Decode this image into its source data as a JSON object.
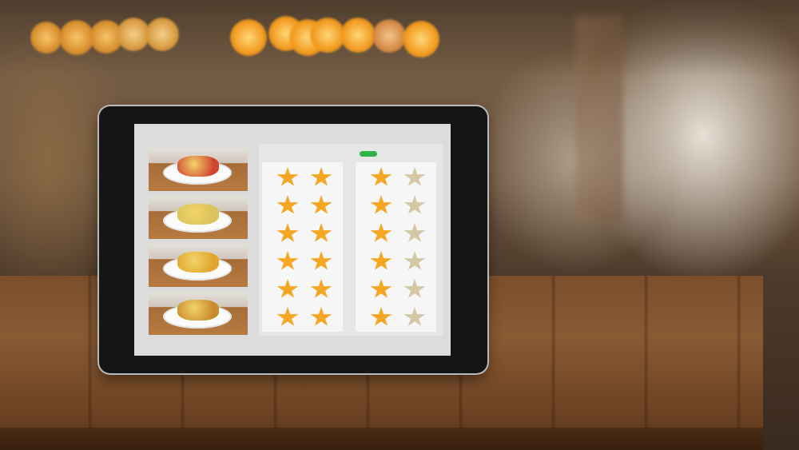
{
  "scene": {
    "description_tags": [
      "restaurant-background",
      "tablet",
      "wooden-table"
    ]
  },
  "tablet": {
    "food_items": [
      {
        "name": "dish-1",
        "color": "#d1452f"
      },
      {
        "name": "dish-2",
        "color": "#d9c25a"
      },
      {
        "name": "dish-3",
        "color": "#e0a52a"
      },
      {
        "name": "dish-4",
        "color": "#c98a2b"
      }
    ],
    "rating_columns": [
      {
        "rows": [
          [
            1,
            1
          ],
          [
            1,
            1
          ],
          [
            1,
            1
          ],
          [
            1,
            1
          ],
          [
            1,
            1
          ],
          [
            1,
            1
          ]
        ]
      },
      {
        "rows": [
          [
            1,
            0
          ],
          [
            1,
            0
          ],
          [
            1,
            0
          ],
          [
            1,
            0
          ],
          [
            1,
            0
          ],
          [
            1,
            0
          ]
        ]
      }
    ],
    "colors": {
      "star_full": "#f5a623",
      "star_empty": "#d4c7a4",
      "indicator": "#32b24a"
    }
  }
}
